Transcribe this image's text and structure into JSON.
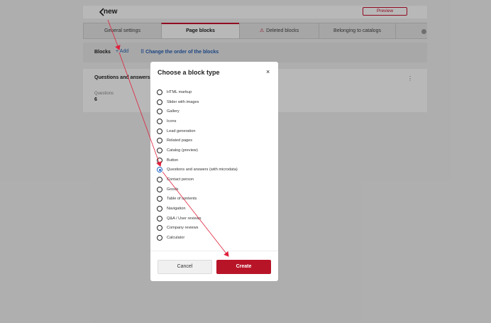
{
  "header": {
    "title": "new",
    "preview_label": "Preview"
  },
  "tabs": [
    {
      "label": "General settings"
    },
    {
      "label": "Page blocks"
    },
    {
      "label": "Deleted blocks"
    },
    {
      "label": "Belonging to catalogs"
    }
  ],
  "blocks_bar": {
    "label": "Blocks",
    "add_label": "+ Add",
    "reorder_label": "⠿ Change the order of the blocks"
  },
  "block_card": {
    "title": "Questions and answers (",
    "field_label": "Questions",
    "field_value": "6"
  },
  "modal": {
    "title": "Choose a block type",
    "close_glyph": "×",
    "options": [
      {
        "label": "HTML markup"
      },
      {
        "label": "Slider with images"
      },
      {
        "label": "Gallery"
      },
      {
        "label": "Icons"
      },
      {
        "label": "Lead generation"
      },
      {
        "label": "Related pages"
      },
      {
        "label": "Catalog (preview)"
      },
      {
        "label": "Button"
      },
      {
        "label": "Questions and answers (with microdata)"
      },
      {
        "label": "Contact person"
      },
      {
        "label": "Goods"
      },
      {
        "label": "Table of contents"
      },
      {
        "label": "Navigation"
      },
      {
        "label": "Q&A / User reviews"
      },
      {
        "label": "Company reviews"
      },
      {
        "label": "Calculator"
      }
    ],
    "selected_index": 8,
    "cancel_label": "Cancel",
    "create_label": "Create"
  },
  "colors": {
    "accent": "#b81428",
    "link": "#2a62b5",
    "radio_selected": "#1f66c7"
  }
}
